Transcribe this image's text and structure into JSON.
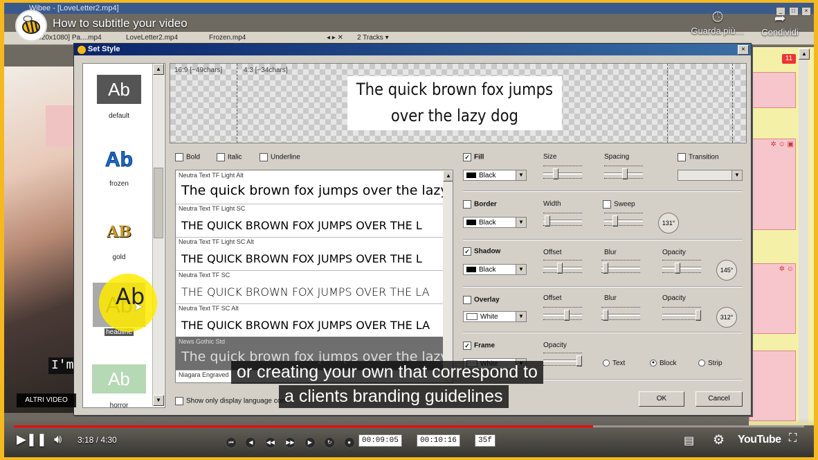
{
  "youtube": {
    "title": "How to subtitle your video",
    "watch_later_label": "Guarda più…",
    "share_label": "Condividi",
    "more_videos_label": "ALTRI VIDEO",
    "time": "3:18 / 4:30",
    "progress": 0.733,
    "logo_text": "YouTube",
    "captions": [
      "or creating your own that correspond to",
      "a clients branding guidelines"
    ]
  },
  "background_app": {
    "window_title": "Wibee - [LoveLetter2.mp4]",
    "tabs": [
      "[1920x1080] Pa....mp4",
      "LoveLetter2.mp4",
      "Frozen.mp4"
    ],
    "tracks_label": "2 Tracks ▾",
    "badge_count": "11",
    "subtitle_fragment": "I'm",
    "timecode_start": "00:09:05",
    "timecode_end": "00:10:16",
    "timecode_fps": "35f"
  },
  "dialog": {
    "title": "Set Style",
    "close_label": "×",
    "styles": [
      {
        "sample": "Ab",
        "label": "default"
      },
      {
        "sample": "Ab",
        "label": "frozen"
      },
      {
        "sample": "AB",
        "label": "gold"
      },
      {
        "sample": "Ab",
        "label": "headline"
      },
      {
        "sample": "Ab",
        "label": "horror"
      }
    ],
    "preview": {
      "ratio_169": "16:9 [~49chars]",
      "ratio_43": "4:3 [~34chars]",
      "line1": "The quick brown fox jumps",
      "line2": "over the lazy dog"
    },
    "format": {
      "bold": "Bold",
      "italic": "Italic",
      "underline": "Underline"
    },
    "fonts": [
      {
        "name": "Neutra Text TF Light Alt",
        "sample": "The quick brown fox jumps over the lazy"
      },
      {
        "name": "Neutra Text TF Light SC",
        "sample": "THE QUICK BROWN FOX JUMPS OVER THE L"
      },
      {
        "name": "Neutra Text TF Light SC Alt",
        "sample": "THE QUICK BROWN FOX JUMPS OVER THE L"
      },
      {
        "name": "Neutra Text TF SC",
        "sample": "THE QUICK BROWN FOX JUMPS OVER THE LA"
      },
      {
        "name": "Neutra Text TF SC Alt",
        "sample": "THE QUICK BROWN FOX JUMPS OVER THE LA"
      },
      {
        "name": "News Gothic Std",
        "sample": "The quick brown fox jumps over the lazy"
      },
      {
        "name": "Niagara Engraved",
        "sample": ""
      }
    ],
    "show_only_label": "Show only display language com",
    "fill": {
      "label": "Fill",
      "color": "Black",
      "size_label": "Size",
      "spacing_label": "Spacing",
      "transition_label": "Transition"
    },
    "border": {
      "label": "Border",
      "color": "Black",
      "width_label": "Width",
      "sweep_label": "Sweep",
      "angle": "131°"
    },
    "shadow": {
      "label": "Shadow",
      "color": "Black",
      "offset_label": "Offset",
      "blur_label": "Blur",
      "opacity_label": "Opacity",
      "angle": "145°"
    },
    "overlay": {
      "label": "Overlay",
      "color": "White",
      "offset_label": "Offset",
      "blur_label": "Blur",
      "opacity_label": "Opacity",
      "angle": "312°"
    },
    "frame": {
      "label": "Frame",
      "color": "White",
      "opacity_label": "Opacity",
      "text_label": "Text",
      "block_label": "Block",
      "strip_label": "Strip"
    },
    "ok_label": "OK",
    "cancel_label": "Cancel"
  },
  "colors": {
    "accent": "#f5b91f",
    "progress": "#ff0000",
    "dialog_title": "#0a246a"
  }
}
